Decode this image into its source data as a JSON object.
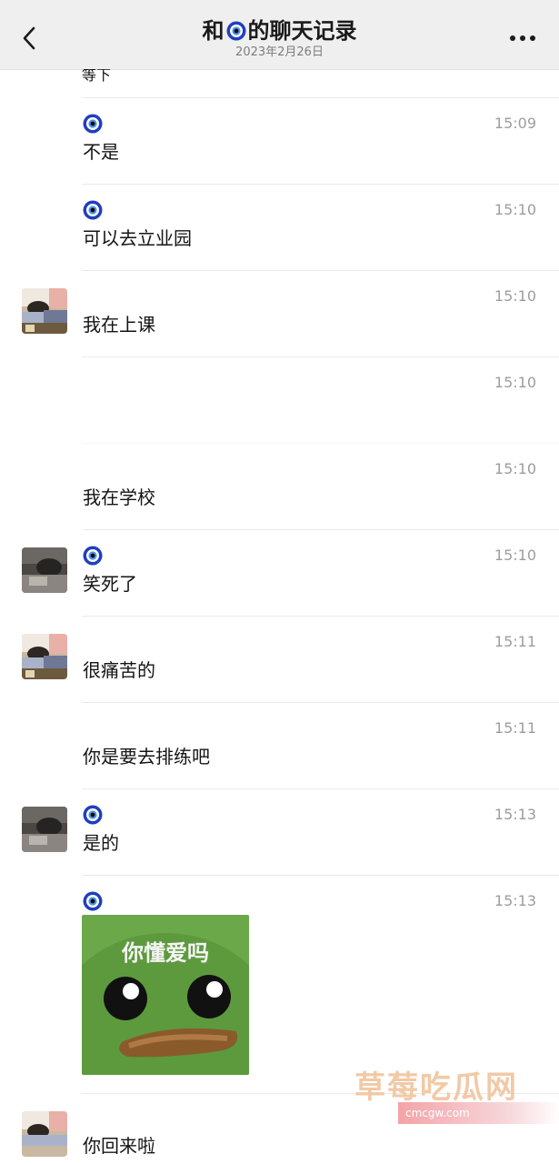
{
  "header": {
    "title_prefix": "和",
    "title_suffix": "的聊天记录",
    "subtitle": "2023年2月26日"
  },
  "chat": {
    "top_partial_text": "等下",
    "messages": [
      {
        "sender": "eye",
        "time": "15:09",
        "text": "不是"
      },
      {
        "sender": "eye",
        "time": "15:10",
        "text": "可以去立业园"
      },
      {
        "sender": "me",
        "time": "15:10",
        "text": "我在上课"
      },
      {
        "sender": "me",
        "time": "15:10",
        "text": ""
      },
      {
        "sender": "me",
        "time": "15:10",
        "text": "我在学校"
      },
      {
        "sender": "eye",
        "time": "15:10",
        "text": "笑死了"
      },
      {
        "sender": "me",
        "time": "15:11",
        "text": "很痛苦的"
      },
      {
        "sender": "me",
        "time": "15:11",
        "text": "你是要去排练吧"
      },
      {
        "sender": "eye",
        "time": "15:13",
        "text": "是的"
      },
      {
        "sender": "eye",
        "time": "15:13",
        "sticker_text": "你懂爱吗"
      },
      {
        "sender": "me",
        "time": "",
        "text": "你回来啦"
      }
    ]
  },
  "watermark": {
    "title": "草莓吃瓜网",
    "url": "cmcgw.com"
  },
  "colors": {
    "header_bg": "#efefef",
    "eye_blue": "#1f3fbf",
    "time_gray": "#9d9d9d",
    "sticker_green": "#5a9a3c"
  },
  "icons": {
    "back": "chevron-left-icon",
    "more": "more-dots-icon",
    "eye": "evil-eye-icon"
  }
}
